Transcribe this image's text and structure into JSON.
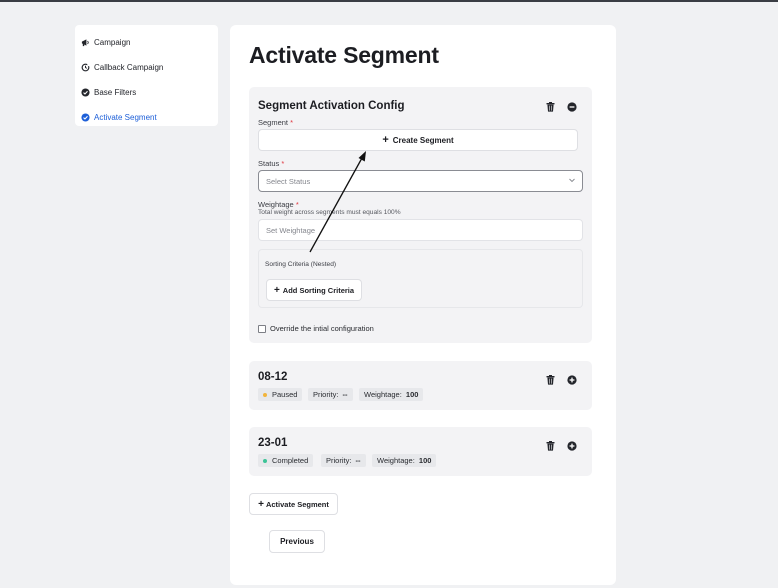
{
  "sidebar": {
    "items": [
      {
        "label": "Campaign",
        "icon": "megaphone-icon"
      },
      {
        "label": "Callback Campaign",
        "icon": "callback-icon"
      },
      {
        "label": "Base Filters",
        "icon": "check-circle-icon"
      },
      {
        "label": "Activate Segment",
        "icon": "check-circle-icon",
        "active": true
      }
    ]
  },
  "main": {
    "title": "Activate Segment",
    "config": {
      "title": "Segment Activation Config",
      "segment_label": "Segment",
      "create_segment": "Create Segment",
      "status_label": "Status",
      "status_placeholder": "Select Status",
      "weightage_label": "Weightage",
      "weightage_hint": "Total weight across segments must equals 100%",
      "weightage_placeholder": "Set Weightage",
      "sorting_title": "Sorting Criteria (Nested)",
      "add_sorting": "Add Sorting Criteria",
      "override_label": "Override the intial configuration",
      "required_mark": "*"
    },
    "segments": [
      {
        "name": "08-12",
        "status": "Paused",
        "status_color": "#f2b43c",
        "priority_label": "Priority:",
        "priority": "--",
        "weightage_label": "Weightage:",
        "weightage": "100"
      },
      {
        "name": "23-01",
        "status": "Completed",
        "status_color": "#3cc497",
        "priority_label": "Priority:",
        "priority": "--",
        "weightage_label": "Weightage:",
        "weightage": "100"
      }
    ],
    "activate_button": "Activate Segment",
    "previous_button": "Previous"
  },
  "colors": {
    "accent": "#1d5fd8",
    "required": "#e0343d"
  }
}
